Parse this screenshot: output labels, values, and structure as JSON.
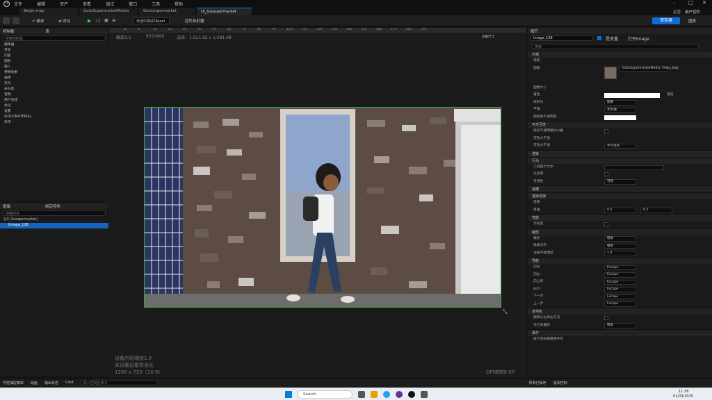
{
  "menu": [
    "文件",
    "编辑",
    "资产",
    "查看",
    "调试",
    "窗口",
    "工具",
    "帮助"
  ],
  "tabs": [
    {
      "label": "Begin-map"
    },
    {
      "label": "GotoSupermarketMedia"
    },
    {
      "label": "Gotosupermarket"
    },
    {
      "label": "UI_Gosupermarket",
      "active": true
    }
  ],
  "window_right": "运营：",
  "window_right2": "用户控件",
  "toolbar": {
    "compile": "编译",
    "diff": "对比",
    "debug_target": "未选中调试Object",
    "bind_label": "控件反射器",
    "save": "保存器",
    "graph": "图表"
  },
  "palette": {
    "title": "控制板",
    "lib": "库",
    "search": "搜索控制板",
    "categories": [
      "编辑器",
      "开发",
      "内容",
      "面板",
      "输入",
      "特殊效果",
      "通用",
      "双元",
      "未归类",
      "音频",
      "用户创建",
      "优化",
      "设置",
      "AUDIOMATERIAL",
      "杂项"
    ]
  },
  "hierarchy": {
    "title": "层级",
    "bind_tab": "绑定控件",
    "search": "搜索控件",
    "root": "[UI_Gosupermarket]",
    "child": "[Image_128"
  },
  "viewport": {
    "zoom": "缩放1:1",
    "size": "637x660",
    "selection": "选择：1,921.92 x 1,081.08",
    "ruler_marks": [
      "10",
      "0",
      "10",
      "20",
      "30",
      "40",
      "50",
      "60",
      "70",
      "80",
      "90",
      "100",
      "110",
      "120",
      "130",
      "140",
      "150",
      "160",
      "170",
      "180",
      "190"
    ],
    "screen_size": "屏幕尺寸",
    "bottom1": "设备内容缩放1.0",
    "bottom2": "未设置设备安全区",
    "bottom3": "1280 x 720（16:9）",
    "dpi": "DPI缩放0.67"
  },
  "details": {
    "title": "细节",
    "name": "Image_128",
    "is_var": "是变量",
    "open": "打开Image",
    "search": "搜索",
    "sections": [
      "外观",
      "笔刷",
      "图像大小",
      "着色",
      "绘制为",
      "平铺",
      "颜色和不透明度"
    ],
    "brush_asset": "GotoSupermarketMedia_Video_Mat",
    "rows": [
      {
        "label": "外观",
        "type": "section"
      },
      {
        "label": "笔刷",
        "type": "row"
      },
      {
        "label": "图像",
        "type": "img"
      },
      {
        "label": "图像大小",
        "type": "row"
      },
      {
        "label": "着色",
        "type": "color",
        "extra": "锁定"
      },
      {
        "label": "绘制为",
        "type": "dd",
        "value": "图像"
      },
      {
        "label": "平铺",
        "type": "dd",
        "value": "无平铺"
      },
      {
        "label": "颜色和不透明度",
        "type": "white"
      },
      {
        "label": "可交互性",
        "type": "section"
      },
      {
        "label": "鼠标不透明模式以触",
        "type": "check"
      },
      {
        "label": "可放大不透",
        "type": "row"
      },
      {
        "label": "可放大不透",
        "type": "dd",
        "value": "不可见的"
      },
      {
        "label": "渲染",
        "type": "section"
      },
      {
        "label": "行为",
        "type": "section"
      },
      {
        "label": "工具提示文本",
        "type": "text"
      },
      {
        "label": "已启用",
        "type": "checked"
      },
      {
        "label": "可视性",
        "type": "dd",
        "value": "可视"
      },
      {
        "label": "插槽",
        "type": "section"
      },
      {
        "label": "渲染变换",
        "type": "section"
      },
      {
        "label": "变换",
        "type": "row"
      },
      {
        "label": "枢轴",
        "type": "pair",
        "v1": "0.5",
        "v2": "0.5"
      },
      {
        "label": "性能",
        "type": "section"
      },
      {
        "label": "为易变",
        "type": "check"
      },
      {
        "label": "裁剪",
        "type": "section"
      },
      {
        "label": "裁剪",
        "type": "dd",
        "value": "继承"
      },
      {
        "label": "像素对齐",
        "type": "dd",
        "value": "继承"
      },
      {
        "label": "渲染不透明度",
        "type": "num",
        "value": "1.0"
      },
      {
        "label": "导航",
        "type": "section"
      },
      {
        "label": "向左",
        "type": "dd",
        "value": "Escape"
      },
      {
        "label": "向右",
        "type": "dd",
        "value": "Escape"
      },
      {
        "label": "向上移",
        "type": "dd",
        "value": "Escape"
      },
      {
        "label": "向下",
        "type": "dd",
        "value": "Escape"
      },
      {
        "label": "下一步",
        "type": "dd",
        "value": "Escape"
      },
      {
        "label": "上一步",
        "type": "dd",
        "value": "Escape"
      },
      {
        "label": "本地化",
        "type": "section"
      },
      {
        "label": "翻译从左到右方向",
        "type": "check"
      },
      {
        "label": "流方向偏好",
        "type": "dd",
        "value": "继承"
      },
      {
        "label": "事件",
        "type": "section"
      },
      {
        "label": "按下鼠标按键事件时",
        "type": "row"
      }
    ]
  },
  "bottombar": {
    "content": "内容抽屉菜单",
    "output": "动画",
    "log": "输出日志",
    "cmd": "Cmd",
    "console": "输入控制台命令",
    "saved": "所有已保存",
    "source": "版本控制"
  },
  "taskbar": {
    "search": "Search",
    "time": "11:38",
    "date": "01/03/2025"
  },
  "colors": {
    "accent": "#0f6bd6",
    "selected": "#1565c0",
    "canvas_border": "#3aa93a"
  }
}
